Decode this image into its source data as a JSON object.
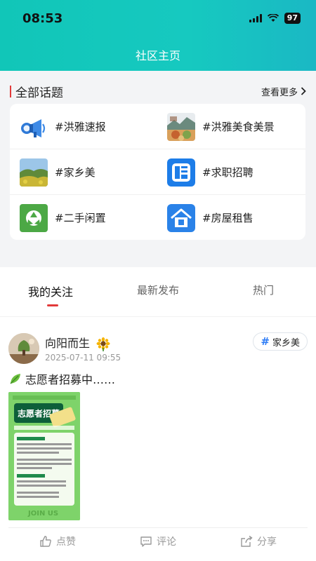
{
  "status_bar": {
    "time": "08:53",
    "battery": "97"
  },
  "header": {
    "title": "社区主页"
  },
  "topics": {
    "title": "全部话题",
    "see_more": "查看更多",
    "items": [
      {
        "label": "#洪雅速报",
        "icon": "megaphone-icon"
      },
      {
        "label": "#洪雅美食美景",
        "icon": "food-scenery-thumbnail"
      },
      {
        "label": "#家乡美",
        "icon": "hometown-thumbnail"
      },
      {
        "label": "#求职招聘",
        "icon": "recruit-icon"
      },
      {
        "label": "#二手闲置",
        "icon": "recycle-icon"
      },
      {
        "label": "#房屋租售",
        "icon": "house-rent-icon"
      }
    ]
  },
  "feed": {
    "tabs": [
      "我的关注",
      "最新发布",
      "热门"
    ],
    "active_tab": "我的关注",
    "post": {
      "author": "向阳而生",
      "time": "2025-07-11 09:55",
      "tag": "家乡美",
      "text": "志愿者招募中……",
      "actions": {
        "like": "点赞",
        "comment": "评论",
        "share": "分享"
      },
      "poster": {
        "title": "志愿者招募",
        "footer": "JOIN US"
      }
    }
  },
  "colors": {
    "accent": "#16c9c0",
    "red": "#e23a3a",
    "blue": "#2e7cf6"
  }
}
